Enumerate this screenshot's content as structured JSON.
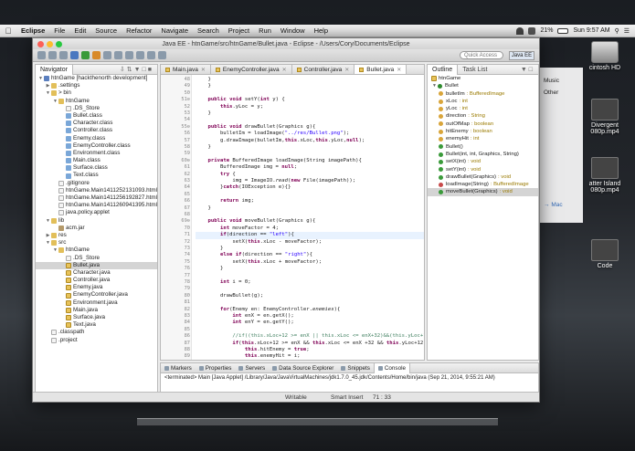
{
  "menubar": {
    "items": [
      "Eclipse",
      "File",
      "Edit",
      "Source",
      "Refactor",
      "Navigate",
      "Search",
      "Project",
      "Run",
      "Window",
      "Help"
    ],
    "battery": "21%",
    "clock": "Sun 9:57 AM"
  },
  "window": {
    "title": "Java EE - htnGame/src/htnGame/Bullet.java - Eclipse - /Users/Cory/Documents/Eclipse"
  },
  "toolbar": {
    "quick_access": "Quick Access",
    "perspective": "Java EE"
  },
  "navigator": {
    "tab": "Navigator",
    "rows": [
      {
        "d": 0,
        "tw": "▼",
        "icon": "proj",
        "label": "htnGame [hackthenorth development]"
      },
      {
        "d": 1,
        "tw": "▶",
        "icon": "folder",
        "label": ".settings"
      },
      {
        "d": 1,
        "tw": "▼",
        "icon": "folder",
        "label": "> bin"
      },
      {
        "d": 2,
        "tw": "▼",
        "icon": "folder",
        "label": "htnGame"
      },
      {
        "d": 3,
        "tw": "",
        "icon": "file",
        "label": ".DS_Store"
      },
      {
        "d": 3,
        "tw": "",
        "icon": "cls",
        "label": "Bullet.class"
      },
      {
        "d": 3,
        "tw": "",
        "icon": "cls",
        "label": "Character.class"
      },
      {
        "d": 3,
        "tw": "",
        "icon": "cls",
        "label": "Controller.class"
      },
      {
        "d": 3,
        "tw": "",
        "icon": "cls",
        "label": "Enemy.class"
      },
      {
        "d": 3,
        "tw": "",
        "icon": "cls",
        "label": "EnemyController.class"
      },
      {
        "d": 3,
        "tw": "",
        "icon": "cls",
        "label": "Environment.class"
      },
      {
        "d": 3,
        "tw": "",
        "icon": "cls",
        "label": "Main.class"
      },
      {
        "d": 3,
        "tw": "",
        "icon": "cls",
        "label": "Surface.class"
      },
      {
        "d": 3,
        "tw": "",
        "icon": "cls",
        "label": "Text.class"
      },
      {
        "d": 2,
        "tw": "",
        "icon": "file",
        "label": ".gitignore"
      },
      {
        "d": 2,
        "tw": "",
        "icon": "file",
        "label": "htnGame.Main1411252131093.html"
      },
      {
        "d": 2,
        "tw": "",
        "icon": "file",
        "label": "htnGame.Main1411256192827.html"
      },
      {
        "d": 2,
        "tw": "",
        "icon": "file",
        "label": "htnGame.Main1411260941395.html"
      },
      {
        "d": 2,
        "tw": "",
        "icon": "file",
        "label": "java.policy.applet"
      },
      {
        "d": 1,
        "tw": "▼",
        "icon": "folder",
        "label": "lib"
      },
      {
        "d": 2,
        "tw": "",
        "icon": "jar",
        "label": "acm.jar"
      },
      {
        "d": 1,
        "tw": "▶",
        "icon": "folder",
        "label": "res"
      },
      {
        "d": 1,
        "tw": "▼",
        "icon": "folder",
        "label": "src"
      },
      {
        "d": 2,
        "tw": "▼",
        "icon": "folder",
        "label": "htnGame"
      },
      {
        "d": 3,
        "tw": "",
        "icon": "file",
        "label": ".DS_Store"
      },
      {
        "d": 3,
        "tw": "",
        "icon": "java",
        "label": "Bullet.java",
        "sel": true
      },
      {
        "d": 3,
        "tw": "",
        "icon": "java",
        "label": "Character.java"
      },
      {
        "d": 3,
        "tw": "",
        "icon": "java",
        "label": "Controller.java"
      },
      {
        "d": 3,
        "tw": "",
        "icon": "java",
        "label": "Enemy.java"
      },
      {
        "d": 3,
        "tw": "",
        "icon": "java",
        "label": "EnemyController.java"
      },
      {
        "d": 3,
        "tw": "",
        "icon": "java",
        "label": "Environment.java"
      },
      {
        "d": 3,
        "tw": "",
        "icon": "java",
        "label": "Main.java"
      },
      {
        "d": 3,
        "tw": "",
        "icon": "java",
        "label": "Surface.java"
      },
      {
        "d": 3,
        "tw": "",
        "icon": "java",
        "label": "Text.java"
      },
      {
        "d": 1,
        "tw": "",
        "icon": "file",
        "label": ".classpath"
      },
      {
        "d": 1,
        "tw": "",
        "icon": "file",
        "label": ".project"
      }
    ]
  },
  "editor": {
    "tabs": [
      {
        "label": "Main.java",
        "active": false
      },
      {
        "label": "EnemyController.java",
        "active": false
      },
      {
        "label": "Controller.java",
        "active": false
      },
      {
        "label": "Bullet.java",
        "active": true
      }
    ],
    "lines": [
      {
        "n": "48",
        "code": "    }"
      },
      {
        "n": "49",
        "code": "    }"
      },
      {
        "n": "50",
        "code": ""
      },
      {
        "n": "51⊖",
        "code": "    <k>public</k> <k>void</k> setY(<k>int</k> y) {"
      },
      {
        "n": "52",
        "code": "        <f>this</f>.yLoc = y;"
      },
      {
        "n": "53",
        "code": "    }"
      },
      {
        "n": "54",
        "code": ""
      },
      {
        "n": "55⊖",
        "code": "    <k>public</k> <k>void</k> drawBullet(Graphics g){"
      },
      {
        "n": "56",
        "code": "        bulletIm = loadImage(<s>\"../res/Bullet.png\"</s>);"
      },
      {
        "n": "57",
        "code": "        g.drawImage(bulletIm,<f>this</f>.xLoc,<f>this</f>.yLoc,<k>null</k>);"
      },
      {
        "n": "58",
        "code": "    }"
      },
      {
        "n": "59",
        "code": ""
      },
      {
        "n": "60⊖",
        "code": "    <k>private</k> BufferedImage loadImage(String imagePath){"
      },
      {
        "n": "61",
        "code": "        BufferedImage img = <k>null</k>;"
      },
      {
        "n": "62",
        "code": "        <k>try</k> {"
      },
      {
        "n": "63",
        "code": "            img = ImageIO.<i>read</i>(<k>new</k> File(imagePath));"
      },
      {
        "n": "64",
        "code": "        }<k>catch</k>(IOException e){}"
      },
      {
        "n": "65",
        "code": ""
      },
      {
        "n": "66",
        "code": "        <k>return</k> img;"
      },
      {
        "n": "67",
        "code": "    }"
      },
      {
        "n": "68",
        "code": ""
      },
      {
        "n": "69⊖",
        "code": "    <k>public</k> <k>void</k> moveBullet(Graphics g){"
      },
      {
        "n": "70",
        "code": "        <k>int</k> moveFactor = 4;"
      },
      {
        "n": "71",
        "code": "        <k>if</k>(direction == <s>\"left\"</s>){",
        "hl": true
      },
      {
        "n": "72",
        "code": "            setX(<f>this</f>.xLoc - moveFactor);"
      },
      {
        "n": "73",
        "code": "        }"
      },
      {
        "n": "74",
        "code": "        <k>else</k> <k>if</k>(direction == <s>\"right\"</s>){"
      },
      {
        "n": "75",
        "code": "            setX(<f>this</f>.xLoc + moveFactor);"
      },
      {
        "n": "76",
        "code": "        }"
      },
      {
        "n": "77",
        "code": ""
      },
      {
        "n": "78",
        "code": "        <k>int</k> i = 0;"
      },
      {
        "n": "79",
        "code": ""
      },
      {
        "n": "80",
        "code": "        drawBullet(g);"
      },
      {
        "n": "81",
        "code": ""
      },
      {
        "n": "82",
        "code": "        <k>for</k>(Enemy en: EnemyController.<i>enemies</i>){"
      },
      {
        "n": "83",
        "code": "            <k>int</k> enX = en.getX();"
      },
      {
        "n": "84",
        "code": "            <k>int</k> enY = en.getY();"
      },
      {
        "n": "85",
        "code": ""
      },
      {
        "n": "86",
        "code": "            <c>//if((this.xLoc+12 >= enX || this.xLoc <= enX+32)&&(this.yLoc+12</c>"
      },
      {
        "n": "87",
        "code": "            <k>if</k>(<f>this</f>.xLoc+12 >= enX && <f>this</f>.xLoc <= enX +32 && <f>this</f>.yLoc+12 >"
      },
      {
        "n": "88",
        "code": "                <f>this</f>.hitEnemy = <k>true</k>;"
      },
      {
        "n": "89",
        "code": "                <f>this</f>.enemyHit = i;"
      },
      {
        "n": "90",
        "code": "                <k>break</k>;"
      }
    ]
  },
  "outline": {
    "tab": "Outline",
    "tab2": "Task List",
    "rows": [
      {
        "d": 0,
        "kind": "pkg",
        "label": "htnGame",
        "type": ""
      },
      {
        "d": 0,
        "kind": "c",
        "label": "Bullet",
        "type": "",
        "tw": "▼"
      },
      {
        "d": 1,
        "kind": "f",
        "label": "bulletIm",
        "type": ": BufferedImage"
      },
      {
        "d": 1,
        "kind": "f",
        "label": "xLoc",
        "type": ": int"
      },
      {
        "d": 1,
        "kind": "f",
        "label": "yLoc",
        "type": ": int"
      },
      {
        "d": 1,
        "kind": "f",
        "label": "direction",
        "type": ": String"
      },
      {
        "d": 1,
        "kind": "f",
        "label": "outOfMap",
        "type": ": boolean"
      },
      {
        "d": 1,
        "kind": "f",
        "label": "hitEnemy",
        "type": ": boolean"
      },
      {
        "d": 1,
        "kind": "f",
        "label": "enemyHit",
        "type": ": int"
      },
      {
        "d": 1,
        "kind": "m",
        "label": "Bullet()",
        "type": ""
      },
      {
        "d": 1,
        "kind": "m",
        "label": "Bullet(int, int, Graphics, String)",
        "type": ""
      },
      {
        "d": 1,
        "kind": "m",
        "label": "setX(int)",
        "type": ": void"
      },
      {
        "d": 1,
        "kind": "m",
        "label": "setY(int)",
        "type": ": void"
      },
      {
        "d": 1,
        "kind": "m",
        "label": "drawBullet(Graphics)",
        "type": ": void"
      },
      {
        "d": 1,
        "kind": "p",
        "label": "loadImage(String)",
        "type": ": BufferedImage"
      },
      {
        "d": 1,
        "kind": "m",
        "label": "moveBullet(Graphics)",
        "type": ": void",
        "sel": true
      }
    ]
  },
  "console": {
    "tabs": [
      "Markers",
      "Properties",
      "Servers",
      "Data Source Explorer",
      "Snippets",
      "Console"
    ],
    "active": "Console",
    "line": "<terminated> Main [Java Applet] /Library/Java/JavaVirtualMachines/jdk1.7.0_45.jdk/Contents/Home/bin/java (Sep 21, 2014, 9:55:21 AM)"
  },
  "status": {
    "writable": "Writable",
    "insert": "Smart Insert",
    "position": "71 : 33"
  },
  "finder": {
    "items": [
      "Music",
      "Other"
    ],
    "mac": "Mac"
  },
  "desktop": [
    {
      "label": "cintosh HD",
      "kind": "hd"
    },
    {
      "label": "Divergent\n080p.mp4",
      "kind": "vid"
    },
    {
      "label": "atter Island\n080p.mp4",
      "kind": "vid"
    },
    {
      "label": "Code",
      "kind": "vid"
    }
  ]
}
